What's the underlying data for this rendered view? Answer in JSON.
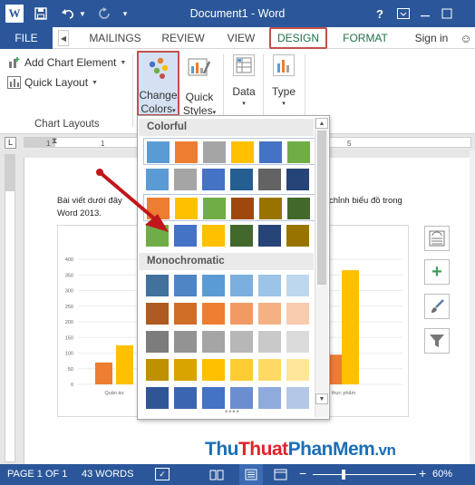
{
  "titlebar": {
    "app_letter": "W",
    "title": "Document1 - Word",
    "help": "?"
  },
  "tabs": {
    "file": "FILE",
    "items": [
      "MAILINGS",
      "REVIEW",
      "VIEW",
      "DESIGN",
      "FORMAT"
    ],
    "sign_in": "Sign in"
  },
  "ribbon": {
    "add_chart_element": "Add Chart Element",
    "quick_layout": "Quick Layout",
    "group_label": "Chart Layouts",
    "change_colors": [
      "Change",
      "Colors"
    ],
    "quick_styles": [
      "Quick",
      "Styles"
    ],
    "data": "Data",
    "type": "Type"
  },
  "ruler": {
    "ticks": [
      "1",
      "1",
      "5"
    ]
  },
  "document": {
    "text_left": "Bài viết dưới đây",
    "text_left_2": "Word 2013.",
    "text_right": "chỉnh biểu đồ trong"
  },
  "chart_data": {
    "type": "bar",
    "y_ticks": [
      "400",
      "350",
      "300",
      "250",
      "200",
      "150",
      "100",
      "50",
      "0"
    ],
    "ylim": [
      0,
      400
    ],
    "visible_x_labels": [
      "Quần áo",
      "thực phẩm"
    ],
    "series": [
      {
        "values_visible_left": [
          70,
          125
        ]
      },
      {
        "values_visible_right": [
          95,
          365
        ]
      }
    ],
    "colors": [
      "#ed7d31",
      "#ffc000"
    ]
  },
  "gallery": {
    "colorful_header": "Colorful",
    "mono_header": "Monochromatic",
    "colorful_rows": [
      [
        "#5b9bd5",
        "#ed7d31",
        "#a5a5a5",
        "#ffc000",
        "#4472c4",
        "#70ad47"
      ],
      [
        "#5b9bd5",
        "#a5a5a5",
        "#4472c4",
        "#255e91",
        "#636363",
        "#264478"
      ],
      [
        "#ed7d31",
        "#ffc000",
        "#70ad47",
        "#9e480e",
        "#997300",
        "#43682b"
      ],
      [
        "#70ad47",
        "#4472c4",
        "#ffc000",
        "#43682b",
        "#264478",
        "#997300"
      ]
    ],
    "mono_rows": [
      [
        "#41719c",
        "#4e85c5",
        "#5b9bd5",
        "#7cafdd",
        "#9dc3e6",
        "#bdd7ee"
      ],
      [
        "#ae5a21",
        "#d06d27",
        "#ed7d31",
        "#f19a63",
        "#f4b183",
        "#f8cbad"
      ],
      [
        "#7c7c7c",
        "#939393",
        "#a5a5a5",
        "#b7b7b7",
        "#c9c9c9",
        "#dbdbdb"
      ],
      [
        "#bf9000",
        "#d9a300",
        "#ffc000",
        "#ffcd33",
        "#ffd966",
        "#ffe699"
      ],
      [
        "#2f5597",
        "#3a65b0",
        "#4472c4",
        "#6a8ed0",
        "#8faadc",
        "#b4c7e7"
      ]
    ]
  },
  "watermark": {
    "part1": "Thu",
    "part2": "Thuat",
    "part3": "PhanMem",
    "part4": ".vn"
  },
  "status": {
    "page": "PAGE 1 OF 1",
    "words": "43 WORDS",
    "zoom": "60%",
    "zoom_level_fraction": 0.3
  },
  "colors": {
    "accent": "#2b579a",
    "highlight_border": "#c0504d",
    "contextual_tab": "#217346"
  }
}
